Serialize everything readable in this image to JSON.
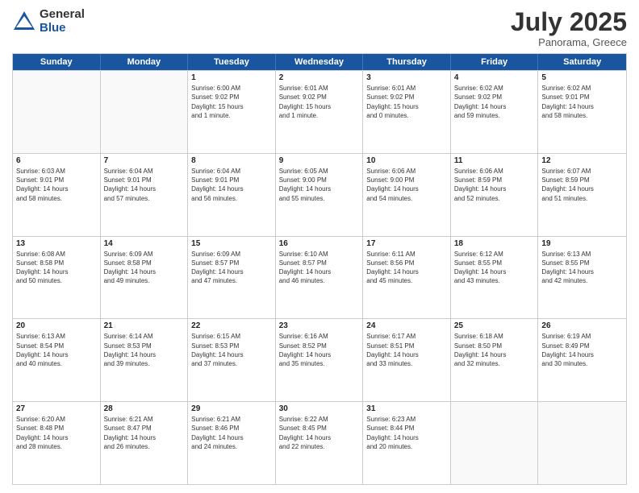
{
  "logo": {
    "general": "General",
    "blue": "Blue"
  },
  "title": "July 2025",
  "location": "Panorama, Greece",
  "header_days": [
    "Sunday",
    "Monday",
    "Tuesday",
    "Wednesday",
    "Thursday",
    "Friday",
    "Saturday"
  ],
  "weeks": [
    [
      {
        "day": "",
        "lines": []
      },
      {
        "day": "",
        "lines": []
      },
      {
        "day": "1",
        "lines": [
          "Sunrise: 6:00 AM",
          "Sunset: 9:02 PM",
          "Daylight: 15 hours",
          "and 1 minute."
        ]
      },
      {
        "day": "2",
        "lines": [
          "Sunrise: 6:01 AM",
          "Sunset: 9:02 PM",
          "Daylight: 15 hours",
          "and 1 minute."
        ]
      },
      {
        "day": "3",
        "lines": [
          "Sunrise: 6:01 AM",
          "Sunset: 9:02 PM",
          "Daylight: 15 hours",
          "and 0 minutes."
        ]
      },
      {
        "day": "4",
        "lines": [
          "Sunrise: 6:02 AM",
          "Sunset: 9:02 PM",
          "Daylight: 14 hours",
          "and 59 minutes."
        ]
      },
      {
        "day": "5",
        "lines": [
          "Sunrise: 6:02 AM",
          "Sunset: 9:01 PM",
          "Daylight: 14 hours",
          "and 58 minutes."
        ]
      }
    ],
    [
      {
        "day": "6",
        "lines": [
          "Sunrise: 6:03 AM",
          "Sunset: 9:01 PM",
          "Daylight: 14 hours",
          "and 58 minutes."
        ]
      },
      {
        "day": "7",
        "lines": [
          "Sunrise: 6:04 AM",
          "Sunset: 9:01 PM",
          "Daylight: 14 hours",
          "and 57 minutes."
        ]
      },
      {
        "day": "8",
        "lines": [
          "Sunrise: 6:04 AM",
          "Sunset: 9:01 PM",
          "Daylight: 14 hours",
          "and 56 minutes."
        ]
      },
      {
        "day": "9",
        "lines": [
          "Sunrise: 6:05 AM",
          "Sunset: 9:00 PM",
          "Daylight: 14 hours",
          "and 55 minutes."
        ]
      },
      {
        "day": "10",
        "lines": [
          "Sunrise: 6:06 AM",
          "Sunset: 9:00 PM",
          "Daylight: 14 hours",
          "and 54 minutes."
        ]
      },
      {
        "day": "11",
        "lines": [
          "Sunrise: 6:06 AM",
          "Sunset: 8:59 PM",
          "Daylight: 14 hours",
          "and 52 minutes."
        ]
      },
      {
        "day": "12",
        "lines": [
          "Sunrise: 6:07 AM",
          "Sunset: 8:59 PM",
          "Daylight: 14 hours",
          "and 51 minutes."
        ]
      }
    ],
    [
      {
        "day": "13",
        "lines": [
          "Sunrise: 6:08 AM",
          "Sunset: 8:58 PM",
          "Daylight: 14 hours",
          "and 50 minutes."
        ]
      },
      {
        "day": "14",
        "lines": [
          "Sunrise: 6:09 AM",
          "Sunset: 8:58 PM",
          "Daylight: 14 hours",
          "and 49 minutes."
        ]
      },
      {
        "day": "15",
        "lines": [
          "Sunrise: 6:09 AM",
          "Sunset: 8:57 PM",
          "Daylight: 14 hours",
          "and 47 minutes."
        ]
      },
      {
        "day": "16",
        "lines": [
          "Sunrise: 6:10 AM",
          "Sunset: 8:57 PM",
          "Daylight: 14 hours",
          "and 46 minutes."
        ]
      },
      {
        "day": "17",
        "lines": [
          "Sunrise: 6:11 AM",
          "Sunset: 8:56 PM",
          "Daylight: 14 hours",
          "and 45 minutes."
        ]
      },
      {
        "day": "18",
        "lines": [
          "Sunrise: 6:12 AM",
          "Sunset: 8:55 PM",
          "Daylight: 14 hours",
          "and 43 minutes."
        ]
      },
      {
        "day": "19",
        "lines": [
          "Sunrise: 6:13 AM",
          "Sunset: 8:55 PM",
          "Daylight: 14 hours",
          "and 42 minutes."
        ]
      }
    ],
    [
      {
        "day": "20",
        "lines": [
          "Sunrise: 6:13 AM",
          "Sunset: 8:54 PM",
          "Daylight: 14 hours",
          "and 40 minutes."
        ]
      },
      {
        "day": "21",
        "lines": [
          "Sunrise: 6:14 AM",
          "Sunset: 8:53 PM",
          "Daylight: 14 hours",
          "and 39 minutes."
        ]
      },
      {
        "day": "22",
        "lines": [
          "Sunrise: 6:15 AM",
          "Sunset: 8:53 PM",
          "Daylight: 14 hours",
          "and 37 minutes."
        ]
      },
      {
        "day": "23",
        "lines": [
          "Sunrise: 6:16 AM",
          "Sunset: 8:52 PM",
          "Daylight: 14 hours",
          "and 35 minutes."
        ]
      },
      {
        "day": "24",
        "lines": [
          "Sunrise: 6:17 AM",
          "Sunset: 8:51 PM",
          "Daylight: 14 hours",
          "and 33 minutes."
        ]
      },
      {
        "day": "25",
        "lines": [
          "Sunrise: 6:18 AM",
          "Sunset: 8:50 PM",
          "Daylight: 14 hours",
          "and 32 minutes."
        ]
      },
      {
        "day": "26",
        "lines": [
          "Sunrise: 6:19 AM",
          "Sunset: 8:49 PM",
          "Daylight: 14 hours",
          "and 30 minutes."
        ]
      }
    ],
    [
      {
        "day": "27",
        "lines": [
          "Sunrise: 6:20 AM",
          "Sunset: 8:48 PM",
          "Daylight: 14 hours",
          "and 28 minutes."
        ]
      },
      {
        "day": "28",
        "lines": [
          "Sunrise: 6:21 AM",
          "Sunset: 8:47 PM",
          "Daylight: 14 hours",
          "and 26 minutes."
        ]
      },
      {
        "day": "29",
        "lines": [
          "Sunrise: 6:21 AM",
          "Sunset: 8:46 PM",
          "Daylight: 14 hours",
          "and 24 minutes."
        ]
      },
      {
        "day": "30",
        "lines": [
          "Sunrise: 6:22 AM",
          "Sunset: 8:45 PM",
          "Daylight: 14 hours",
          "and 22 minutes."
        ]
      },
      {
        "day": "31",
        "lines": [
          "Sunrise: 6:23 AM",
          "Sunset: 8:44 PM",
          "Daylight: 14 hours",
          "and 20 minutes."
        ]
      },
      {
        "day": "",
        "lines": []
      },
      {
        "day": "",
        "lines": []
      }
    ]
  ]
}
